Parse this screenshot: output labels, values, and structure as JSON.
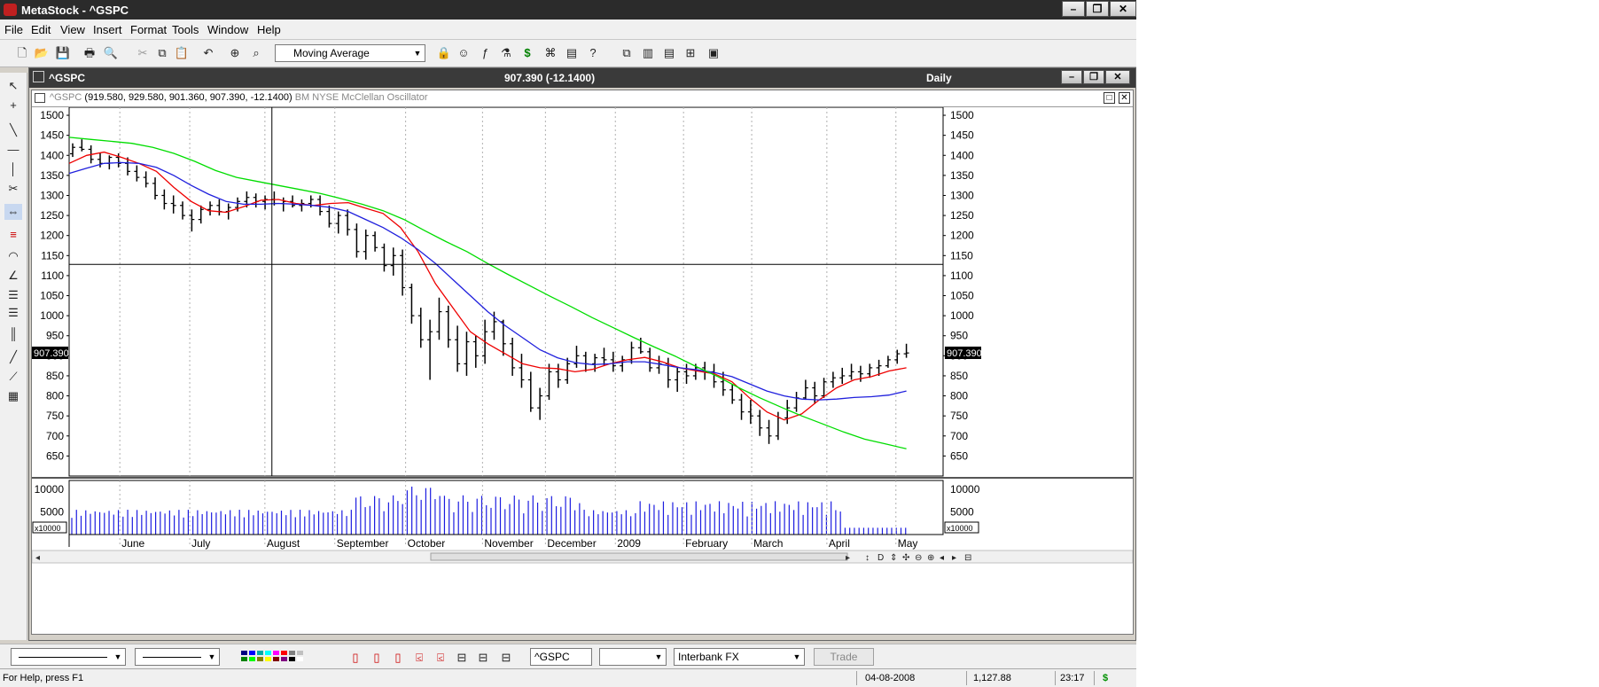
{
  "app": {
    "title": "MetaStock - ^GSPC",
    "win_min": "–",
    "win_max": "❐",
    "win_close": "✕"
  },
  "menu": [
    "File",
    "Edit",
    "View",
    "Insert",
    "Format",
    "Tools",
    "Window",
    "Help"
  ],
  "toolbar": {
    "indicator_combo": "Moving Average"
  },
  "chart_window": {
    "title": "^GSPC",
    "last": "907.390 (-12.1400)",
    "periodicity": "Daily",
    "info_symbol": "^GSPC",
    "info_values": "(919.580, 929.580, 901.360, 907.390, -12.1400)",
    "info_overlay": "BM NYSE McClellan Oscillator",
    "last_price_label": "907.390",
    "volume_multiplier": "x10000",
    "child_min": "–",
    "child_max": "❐",
    "child_close": "✕",
    "pane_max": "□",
    "pane_close": "✕"
  },
  "chart_data": {
    "type": "candlestick",
    "ylim": [
      600,
      1520
    ],
    "yticks": [
      650,
      700,
      750,
      800,
      850,
      900,
      950,
      1000,
      1050,
      1100,
      1150,
      1200,
      1250,
      1300,
      1350,
      1400,
      1450,
      1500
    ],
    "xticks": [
      "June",
      "July",
      "August",
      "September",
      "October",
      "November",
      "December",
      "2009",
      "February",
      "March",
      "April",
      "May"
    ],
    "crosshair": {
      "date": "04-08-2008",
      "price": "1,127.88"
    },
    "moving_averages": [
      {
        "color": "#ee0000",
        "values": [
          1380,
          1400,
          1408,
          1395,
          1380,
          1360,
          1320,
          1285,
          1262,
          1258,
          1272,
          1288,
          1290,
          1280,
          1275,
          1280,
          1282,
          1268,
          1255,
          1220,
          1160,
          1080,
          1020,
          960,
          930,
          905,
          880,
          870,
          868,
          860,
          866,
          880,
          890,
          896,
          885,
          870,
          862,
          855,
          835,
          795,
          760,
          740,
          755,
          790,
          820,
          840,
          848,
          862,
          870
        ]
      },
      {
        "color": "#2020dd",
        "values": [
          1355,
          1368,
          1380,
          1382,
          1380,
          1370,
          1350,
          1325,
          1303,
          1285,
          1278,
          1278,
          1280,
          1278,
          1275,
          1270,
          1260,
          1240,
          1220,
          1195,
          1165,
          1130,
          1090,
          1050,
          1010,
          975,
          945,
          915,
          895,
          883,
          878,
          880,
          885,
          885,
          878,
          870,
          865,
          858,
          848,
          830,
          812,
          800,
          792,
          790,
          792,
          796,
          798,
          802,
          812
        ]
      },
      {
        "color": "#00dd00",
        "values": [
          1445,
          1440,
          1435,
          1430,
          1420,
          1405,
          1385,
          1362,
          1345,
          1335,
          1325,
          1315,
          1305,
          1292,
          1278,
          1262,
          1240,
          1212,
          1185,
          1160,
          1130,
          1102,
          1075,
          1048,
          1022,
          995,
          970,
          945,
          921,
          898,
          872,
          848,
          820,
          795,
          772,
          750,
          730,
          710,
          692,
          680,
          668
        ]
      }
    ],
    "bars": [
      [
        1404,
        1430,
        1396,
        1420
      ],
      [
        1420,
        1440,
        1410,
        1415
      ],
      [
        1415,
        1425,
        1380,
        1390
      ],
      [
        1390,
        1405,
        1370,
        1380
      ],
      [
        1380,
        1400,
        1365,
        1395
      ],
      [
        1395,
        1405,
        1370,
        1380
      ],
      [
        1380,
        1395,
        1350,
        1360
      ],
      [
        1360,
        1375,
        1335,
        1345
      ],
      [
        1345,
        1360,
        1320,
        1330
      ],
      [
        1330,
        1345,
        1290,
        1300
      ],
      [
        1300,
        1315,
        1265,
        1280
      ],
      [
        1280,
        1300,
        1255,
        1275
      ],
      [
        1275,
        1285,
        1240,
        1250
      ],
      [
        1250,
        1265,
        1210,
        1240
      ],
      [
        1240,
        1275,
        1230,
        1265
      ],
      [
        1265,
        1285,
        1250,
        1275
      ],
      [
        1275,
        1290,
        1250,
        1260
      ],
      [
        1260,
        1280,
        1240,
        1270
      ],
      [
        1270,
        1295,
        1260,
        1285
      ],
      [
        1285,
        1310,
        1270,
        1295
      ],
      [
        1295,
        1305,
        1270,
        1285
      ],
      [
        1285,
        1300,
        1265,
        1290
      ],
      [
        1290,
        1310,
        1275,
        1280
      ],
      [
        1280,
        1295,
        1260,
        1285
      ],
      [
        1285,
        1300,
        1270,
        1275
      ],
      [
        1275,
        1290,
        1260,
        1280
      ],
      [
        1280,
        1300,
        1270,
        1290
      ],
      [
        1290,
        1300,
        1250,
        1260
      ],
      [
        1260,
        1275,
        1220,
        1230
      ],
      [
        1230,
        1260,
        1205,
        1250
      ],
      [
        1250,
        1265,
        1200,
        1215
      ],
      [
        1215,
        1230,
        1145,
        1160
      ],
      [
        1160,
        1215,
        1140,
        1200
      ],
      [
        1200,
        1210,
        1160,
        1170
      ],
      [
        1170,
        1180,
        1110,
        1125
      ],
      [
        1125,
        1170,
        1100,
        1150
      ],
      [
        1150,
        1165,
        1050,
        1070
      ],
      [
        1070,
        1080,
        980,
        1000
      ],
      [
        1000,
        1020,
        920,
        940
      ],
      [
        940,
        990,
        840,
        960
      ],
      [
        960,
        1045,
        940,
        1010
      ],
      [
        1010,
        1025,
        920,
        940
      ],
      [
        940,
        975,
        860,
        880
      ],
      [
        880,
        960,
        850,
        935
      ],
      [
        935,
        950,
        870,
        900
      ],
      [
        900,
        990,
        880,
        960
      ],
      [
        960,
        1010,
        940,
        985
      ],
      [
        985,
        990,
        900,
        930
      ],
      [
        930,
        945,
        850,
        870
      ],
      [
        870,
        905,
        820,
        840
      ],
      [
        840,
        860,
        760,
        770
      ],
      [
        770,
        820,
        740,
        800
      ],
      [
        800,
        880,
        790,
        860
      ],
      [
        860,
        880,
        820,
        840
      ],
      [
        840,
        895,
        830,
        880
      ],
      [
        880,
        925,
        870,
        900
      ],
      [
        900,
        910,
        860,
        880
      ],
      [
        880,
        905,
        860,
        895
      ],
      [
        895,
        920,
        875,
        890
      ],
      [
        890,
        910,
        860,
        875
      ],
      [
        875,
        900,
        860,
        890
      ],
      [
        890,
        935,
        880,
        920
      ],
      [
        920,
        945,
        905,
        910
      ],
      [
        910,
        920,
        860,
        870
      ],
      [
        870,
        900,
        855,
        880
      ],
      [
        880,
        895,
        820,
        840
      ],
      [
        840,
        870,
        810,
        860
      ],
      [
        860,
        880,
        830,
        850
      ],
      [
        850,
        880,
        840,
        870
      ],
      [
        870,
        885,
        840,
        860
      ],
      [
        860,
        880,
        820,
        835
      ],
      [
        835,
        860,
        800,
        815
      ],
      [
        815,
        830,
        780,
        790
      ],
      [
        790,
        805,
        740,
        760
      ],
      [
        760,
        790,
        730,
        750
      ],
      [
        750,
        765,
        700,
        720
      ],
      [
        720,
        740,
        680,
        700
      ],
      [
        700,
        760,
        690,
        745
      ],
      [
        745,
        790,
        730,
        770
      ],
      [
        770,
        810,
        760,
        795
      ],
      [
        795,
        840,
        790,
        820
      ],
      [
        820,
        835,
        780,
        800
      ],
      [
        800,
        845,
        795,
        835
      ],
      [
        835,
        860,
        820,
        845
      ],
      [
        845,
        870,
        830,
        850
      ],
      [
        850,
        880,
        840,
        860
      ],
      [
        860,
        875,
        835,
        855
      ],
      [
        855,
        880,
        845,
        870
      ],
      [
        870,
        890,
        850,
        875
      ],
      [
        875,
        900,
        870,
        890
      ],
      [
        890,
        915,
        880,
        905
      ],
      [
        905,
        930,
        895,
        907
      ]
    ],
    "volume": {
      "ylim": [
        0,
        12000
      ],
      "yticks": [
        5000,
        10000
      ]
    }
  },
  "bottom": {
    "symbol": "^GSPC",
    "provider": "Interbank FX",
    "trade": "Trade"
  },
  "status": {
    "help": "For Help, press F1",
    "date": "04-08-2008",
    "price": "1,127.88",
    "time": "23:17",
    "dollar": "$"
  }
}
